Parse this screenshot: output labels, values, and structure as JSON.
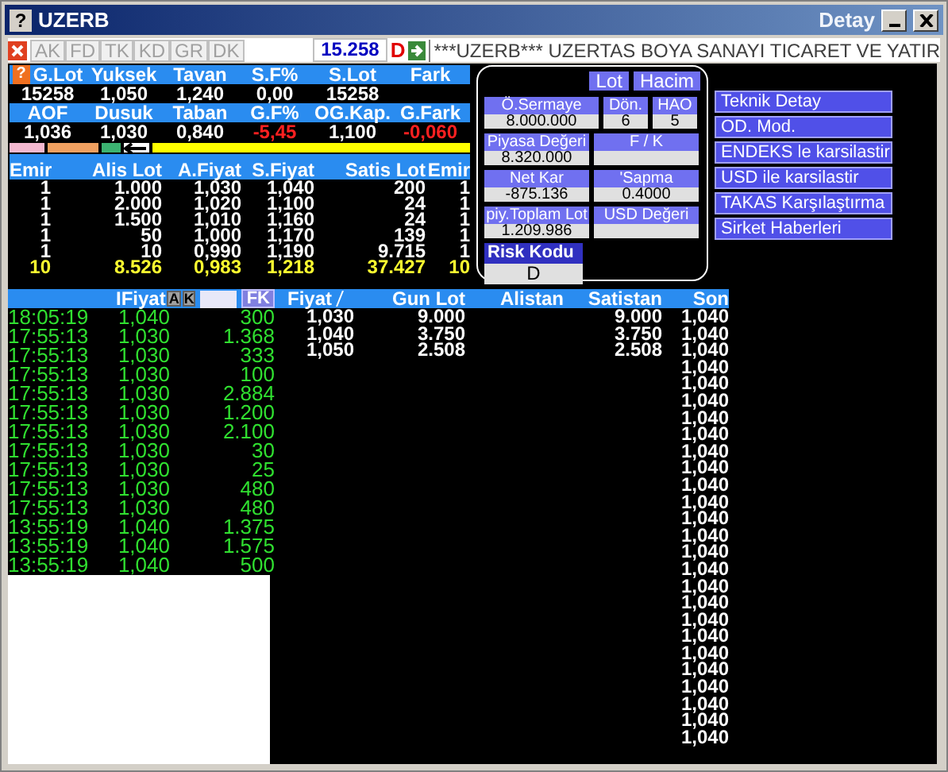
{
  "window": {
    "help": "?",
    "title": "UZERB",
    "subtitle": "Detay"
  },
  "toolbar": {
    "buttons": [
      {
        "label": "AK",
        "disabled": true
      },
      {
        "label": "FD",
        "disabled": true
      },
      {
        "label": "TK",
        "disabled": true
      },
      {
        "label": "KD",
        "disabled": true
      },
      {
        "label": "GR",
        "disabled": true
      },
      {
        "label": "DK",
        "disabled": true
      }
    ],
    "value": "15.258",
    "mode": "D",
    "ticker": "***UZERB*** UZERTAS BOYA SANAYI TICARET VE YATIR"
  },
  "quote": {
    "help": "?",
    "rows": [
      [
        {
          "label": "G.Lot",
          "value": "15258",
          "negative": false
        },
        {
          "label": "Yuksek",
          "value": "1,050",
          "negative": false
        },
        {
          "label": "Tavan",
          "value": "1,240",
          "negative": false
        },
        {
          "label": "S.F%",
          "value": "0,00",
          "negative": false
        },
        {
          "label": "S.Lot",
          "value": "15258",
          "negative": false
        },
        {
          "label": "Fark"
        }
      ],
      [
        {
          "label": "AOF",
          "value": "1,036",
          "negative": false
        },
        {
          "label": "Dusuk",
          "value": "1,030",
          "negative": false
        },
        {
          "label": "Taban",
          "value": "0,840",
          "negative": false
        },
        {
          "label": "G.F%",
          "value": "-5,45",
          "negative": true
        },
        {
          "label": "OG.Kap.",
          "value": "1,100",
          "negative": false
        },
        {
          "label": "G.Fark",
          "value": "-0,060",
          "negative": true
        }
      ]
    ],
    "bar": [
      {
        "color": "#f4b8d0"
      },
      {
        "color": "#f0a060"
      },
      {
        "color": "#3cb371"
      },
      {
        "color": "#ffff00"
      }
    ]
  },
  "orderbook": {
    "columns": [
      "Emir",
      "Alis Lot",
      "A.Fiyat",
      "S.Fiyat",
      "Satis Lot",
      "Emir"
    ],
    "rows": [
      [
        "1",
        "1.000",
        "1,030",
        "1,040",
        "200",
        "1"
      ],
      [
        "1",
        "2.000",
        "1,020",
        "1,100",
        "24",
        "1"
      ],
      [
        "1",
        "1.500",
        "1,010",
        "1,160",
        "24",
        "1"
      ],
      [
        "1",
        "50",
        "1,000",
        "1,170",
        "139",
        "1"
      ],
      [
        "1",
        "10",
        "0,990",
        "1,190",
        "9.715",
        "1"
      ]
    ],
    "total": [
      "10",
      "8.526",
      "0,983",
      "1,218",
      "37.427",
      "10"
    ]
  },
  "panel": {
    "toggles": [
      "Lot",
      "Hacim"
    ],
    "rows": [
      [
        {
          "label": "Ö.Sermaye",
          "value": "8.000.000"
        },
        {
          "label": "Dön.",
          "value": "6"
        },
        {
          "label": "HAO",
          "value": "5"
        }
      ],
      [
        {
          "label": "Piyasa Değeri",
          "value": "8.320.000"
        },
        {
          "label": "F / K"
        }
      ],
      [
        {
          "label": "Net Kar",
          "value": "-875.136"
        },
        {
          "label": "'Sapma",
          "value": "0.4000"
        }
      ],
      [
        {
          "label": "piy.Toplam Lot",
          "value": "1.209.986"
        },
        {
          "label": "USD Değeri"
        }
      ]
    ],
    "risk": {
      "label": "Risk Kodu",
      "value": "D"
    }
  },
  "actions": [
    "Teknik Detay",
    "OD. Mod.",
    "ENDEKS le karsilastir",
    "USD ile karsilastir",
    "TAKAS Karşılaştırma",
    "Sirket Haberleri"
  ],
  "trades": {
    "header": "IFiyat",
    "buttons": [
      "A",
      "K"
    ],
    "filter_button": "FK",
    "rows": [
      [
        "18:05:19",
        "1,040",
        "300"
      ],
      [
        "17:55:13",
        "1,030",
        "1.368"
      ],
      [
        "17:55:13",
        "1,030",
        "333"
      ],
      [
        "17:55:13",
        "1,030",
        "100"
      ],
      [
        "17:55:13",
        "1,030",
        "2.884"
      ],
      [
        "17:55:13",
        "1,030",
        "1.200"
      ],
      [
        "17:55:13",
        "1,030",
        "2.100"
      ],
      [
        "17:55:13",
        "1,030",
        "30"
      ],
      [
        "17:55:13",
        "1,030",
        "25"
      ],
      [
        "17:55:13",
        "1,030",
        "480"
      ],
      [
        "17:55:13",
        "1,030",
        "480"
      ],
      [
        "13:55:19",
        "1,040",
        "1.375"
      ],
      [
        "13:55:19",
        "1,040",
        "1.575"
      ],
      [
        "13:55:19",
        "1,040",
        "500"
      ]
    ]
  },
  "prices": {
    "columns": [
      "Fiyat",
      "Gun Lot",
      "Alistan",
      "Satistan",
      "Son"
    ],
    "rows": [
      {
        "fiyat": "1,030",
        "gun_lot": "9.000",
        "satistan": "9.000",
        "son": "1,040"
      },
      {
        "fiyat": "1,040",
        "gun_lot": "3.750",
        "satistan": "3.750",
        "son": "1,040"
      },
      {
        "fiyat": "1,050",
        "gun_lot": "2.508",
        "satistan": "2.508",
        "son": "1,040"
      },
      {
        "son": "1,040"
      },
      {
        "son": "1,040"
      },
      {
        "son": "1,040"
      },
      {
        "son": "1,040"
      },
      {
        "son": "1,040"
      },
      {
        "son": "1,040"
      },
      {
        "son": "1,040"
      },
      {
        "son": "1,040"
      },
      {
        "son": "1,040"
      },
      {
        "son": "1,040"
      },
      {
        "son": "1,040"
      },
      {
        "son": "1,040"
      },
      {
        "son": "1,040"
      },
      {
        "son": "1,040"
      },
      {
        "son": "1,040"
      },
      {
        "son": "1,040"
      },
      {
        "son": "1,040"
      },
      {
        "son": "1,040"
      },
      {
        "son": "1,040"
      },
      {
        "son": "1,040"
      },
      {
        "son": "1,040"
      },
      {
        "son": "1,040"
      },
      {
        "son": "1,040"
      }
    ]
  }
}
